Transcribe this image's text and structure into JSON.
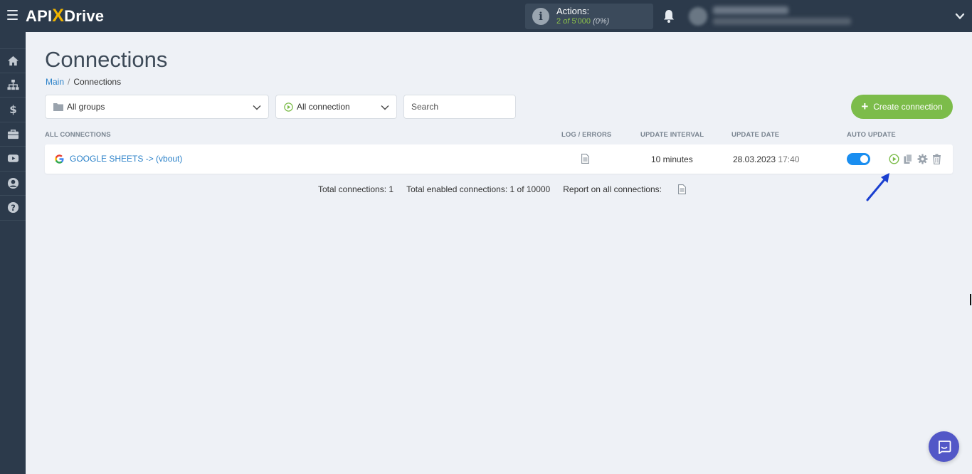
{
  "app": {
    "logo_prefix": "API",
    "logo_x": "X",
    "logo_suffix": "Drive"
  },
  "header": {
    "actions_label": "Actions:",
    "actions_used": "2",
    "actions_of": "of",
    "actions_total": "5'000",
    "actions_percent": "(0%)"
  },
  "sidebar": {
    "items": [
      {
        "icon": "home-icon"
      },
      {
        "icon": "sitemap-icon"
      },
      {
        "icon": "dollar-icon"
      },
      {
        "icon": "briefcase-icon"
      },
      {
        "icon": "youtube-icon"
      },
      {
        "icon": "user-icon"
      },
      {
        "icon": "help-icon"
      }
    ]
  },
  "page": {
    "title": "Connections",
    "breadcrumb_main": "Main",
    "breadcrumb_sep": "/",
    "breadcrumb_current": "Connections"
  },
  "filters": {
    "groups_value": "All groups",
    "connection_value": "All connection",
    "search_placeholder": "Search",
    "create_label": "Create connection"
  },
  "table": {
    "headers": {
      "all": "ALL CONNECTIONS",
      "log": "LOG / ERRORS",
      "interval": "UPDATE INTERVAL",
      "date": "UPDATE DATE",
      "auto": "AUTO UPDATE"
    },
    "rows": [
      {
        "name": "GOOGLE SHEETS -> (vbout)",
        "interval": "10 minutes",
        "date": "28.03.2023",
        "time": "17:40",
        "auto_update": true
      }
    ]
  },
  "totals": {
    "total": "Total connections: 1",
    "enabled": "Total enabled connections: 1 of 10000",
    "report": "Report on all connections:"
  },
  "colors": {
    "topbar": "#2c3a4b",
    "accent_green": "#7cbc4a",
    "link_blue": "#2c82c9",
    "toggle_blue": "#1a8ef0",
    "chat_purple": "#5257c7"
  }
}
